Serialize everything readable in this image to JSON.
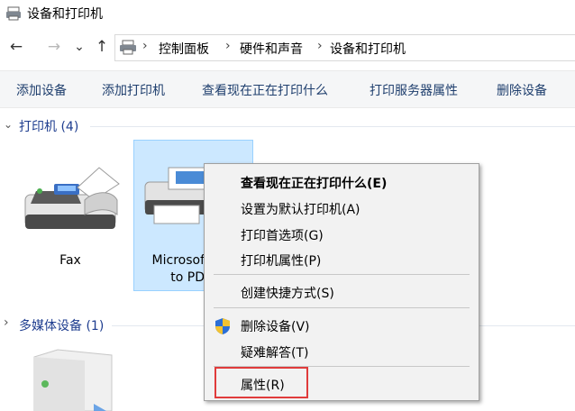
{
  "window": {
    "title": "设备和打印机",
    "icon": "printer-folder-icon"
  },
  "nav": {
    "back": "←",
    "forward": "→",
    "recent": "⌄",
    "up": "↑"
  },
  "address": {
    "icon": "control-panel-icon",
    "sep": "›",
    "crumbs": [
      "控制面板",
      "硬件和声音",
      "设备和打印机"
    ]
  },
  "commands": [
    "添加设备",
    "添加打印机",
    "查看现在正在打印什么",
    "打印服务器属性",
    "删除设备"
  ],
  "groups": {
    "printers": {
      "chevron": "⌄",
      "title": "打印机 (4)"
    },
    "multimedia": {
      "chevron": "›",
      "title": "多媒体设备 (1)"
    }
  },
  "devices": {
    "fax": {
      "label": "Fax",
      "icon": "fax-icon"
    },
    "pdf": {
      "label_line1": "Microsof",
      "label_line2": "to PD",
      "icon": "printer-icon"
    },
    "media": {
      "icon": "media-server-icon"
    }
  },
  "context_menu": {
    "items": [
      {
        "label": "查看现在正在打印什么(E)",
        "bold": true
      },
      {
        "label": "设置为默认打印机(A)"
      },
      {
        "label": "打印首选项(G)"
      },
      {
        "label": "打印机属性(P)"
      },
      {
        "label": "创建快捷方式(S)"
      },
      {
        "label": "删除设备(V)",
        "icon": "uac-shield-icon"
      },
      {
        "label": "疑难解答(T)"
      },
      {
        "label": "属性(R)",
        "highlighted": true
      }
    ]
  },
  "colors": {
    "link": "#1e3d8f",
    "command": "#1f3f6e",
    "selection": "#cce8ff",
    "highlight_box": "#e03b3b"
  }
}
